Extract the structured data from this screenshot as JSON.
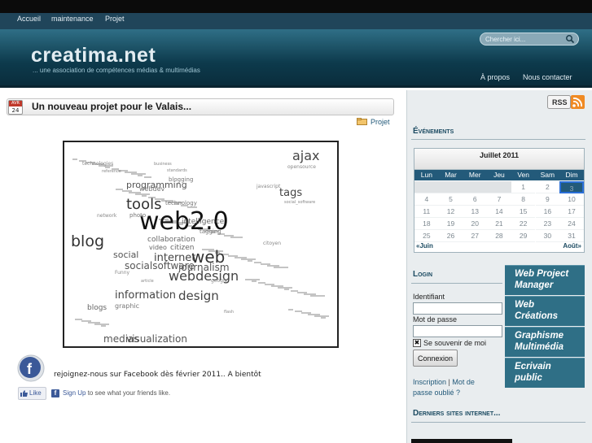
{
  "menu": {
    "items": [
      "Accueil",
      "maintenance",
      "Projet"
    ]
  },
  "header": {
    "title": "creatima.net",
    "tagline": "... une association de compétences médias & multimédias",
    "search_placeholder": "Chercher ici...",
    "nav": [
      "À propos",
      "Nous contacter"
    ]
  },
  "post": {
    "date_month": "AVR",
    "date_day": "24",
    "title": "Un nouveau projet pour le Valais...",
    "category": "Projet",
    "facebook_text": "rejoignez-nous sur Facebook dès février 2011.. A bientôt",
    "like_label": "Like",
    "signup_link": "Sign Up",
    "signup_rest": " to see what your friends like."
  },
  "tag_cloud": [
    {
      "text": "ajax",
      "size": 16,
      "color": "#444"
    },
    {
      "text": "opensource",
      "size": 6,
      "color": "#888"
    },
    {
      "text": "technologies",
      "size": 6,
      "color": "#888"
    },
    {
      "text": "business",
      "size": 5,
      "color": "#888"
    },
    {
      "text": "reference",
      "size": 5,
      "color": "#888"
    },
    {
      "text": "standards",
      "size": 5,
      "color": "#888"
    },
    {
      "text": "blogging",
      "size": 7,
      "color": "#777"
    },
    {
      "text": "programming",
      "size": 11,
      "color": "#555"
    },
    {
      "text": "webdev",
      "size": 8,
      "color": "#777"
    },
    {
      "text": "javascript",
      "size": 6,
      "color": "#888"
    },
    {
      "text": "tags",
      "size": 13,
      "color": "#444"
    },
    {
      "text": "tools",
      "size": 18,
      "color": "#333"
    },
    {
      "text": "technology",
      "size": 7,
      "color": "#777"
    },
    {
      "text": "web2.0",
      "size": 30,
      "color": "#111"
    },
    {
      "text": "social_software",
      "size": 5,
      "color": "#888"
    },
    {
      "text": "intelligence",
      "size": 9,
      "color": "#666"
    },
    {
      "text": "network",
      "size": 6,
      "color": "#888"
    },
    {
      "text": "photo",
      "size": 7,
      "color": "#777"
    },
    {
      "text": "tagging",
      "size": 7,
      "color": "#777"
    },
    {
      "text": "collaboration",
      "size": 9,
      "color": "#666"
    },
    {
      "text": "blog",
      "size": 19,
      "color": "#333"
    },
    {
      "text": "video",
      "size": 8,
      "color": "#666"
    },
    {
      "text": "citizen",
      "size": 9,
      "color": "#666"
    },
    {
      "text": "citoyen",
      "size": 6,
      "color": "#888"
    },
    {
      "text": "social",
      "size": 11,
      "color": "#555"
    },
    {
      "text": "internet",
      "size": 13,
      "color": "#444"
    },
    {
      "text": "web",
      "size": 20,
      "color": "#333"
    },
    {
      "text": "journalism",
      "size": 12,
      "color": "#555"
    },
    {
      "text": "socialsoftware",
      "size": 12,
      "color": "#555"
    },
    {
      "text": "webdesign",
      "size": 16,
      "color": "#444"
    },
    {
      "text": "Funny",
      "size": 6,
      "color": "#888"
    },
    {
      "text": "information",
      "size": 13,
      "color": "#444"
    },
    {
      "text": "design",
      "size": 15,
      "color": "#444"
    },
    {
      "text": "blogs",
      "size": 9,
      "color": "#666"
    },
    {
      "text": "graphic",
      "size": 8,
      "color": "#777"
    },
    {
      "text": "flash",
      "size": 5,
      "color": "#888"
    },
    {
      "text": "medias",
      "size": 12,
      "color": "#555"
    },
    {
      "text": "visualization",
      "size": 12,
      "color": "#555"
    },
    {
      "text": "google",
      "size": 6,
      "color": "#888"
    },
    {
      "text": "article",
      "size": 5,
      "color": "#888"
    }
  ],
  "sidebar": {
    "rss_label": "RSS",
    "events_title": "Événements",
    "calendar": {
      "caption": "Juillet 2011",
      "headers": [
        "Lun",
        "Mar",
        "Mer",
        "Jeu",
        "Ven",
        "Sam",
        "Dim"
      ],
      "days": [
        "1",
        "2",
        "3",
        "4",
        "5",
        "6",
        "7",
        "8",
        "9",
        "10",
        "11",
        "12",
        "13",
        "14",
        "15",
        "16",
        "17",
        "18",
        "19",
        "20",
        "21",
        "22",
        "23",
        "24",
        "25",
        "26",
        "27",
        "28",
        "29",
        "30",
        "31"
      ],
      "first_weekday_index": 4,
      "today": "3",
      "prev": "«Juin",
      "next": "Août»"
    },
    "login_title": "Login",
    "username_label": "Identifiant",
    "password_label": "Mot de passe",
    "remember_label": "Se souvenir de moi",
    "login_button": "Connexion",
    "register_link": "Inscription",
    "forgot_link": "Mot de passe oublié ?",
    "latest_sites_title": "Derniers sites internet...",
    "promo_items": [
      {
        "line1": "Web Project",
        "line2": "Manager"
      },
      {
        "line1": "Web",
        "line2": "Créations"
      },
      {
        "line1": "Graphisme",
        "line2": "Multimédia"
      },
      {
        "line1": "Ecrivain",
        "line2": "public"
      }
    ]
  }
}
